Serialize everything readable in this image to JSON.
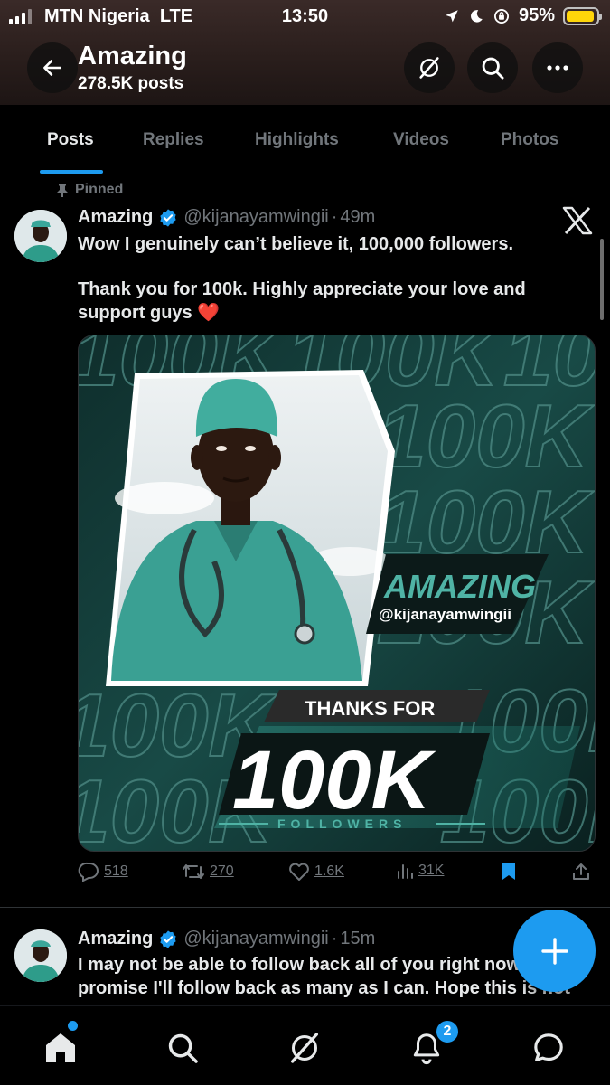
{
  "status_bar": {
    "carrier": "MTN Nigeria",
    "network": "LTE",
    "time": "13:50",
    "battery": "95%",
    "battery_level": 0.95,
    "battery_color": "#ffd60a"
  },
  "header": {
    "back_icon": "arrow-left-icon",
    "name": "Amazing",
    "posts_count": "278.5K posts",
    "grok_icon": "grok-icon",
    "search_icon": "search-icon",
    "more_icon": "more-icon"
  },
  "tabs": [
    {
      "label": "Posts",
      "active": true
    },
    {
      "label": "Replies",
      "active": false
    },
    {
      "label": "Highlights",
      "active": false
    },
    {
      "label": "Videos",
      "active": false
    },
    {
      "label": "Photos",
      "active": false
    }
  ],
  "pinned_post": {
    "pinned_label": "Pinned",
    "author": "Amazing",
    "handle": "@kijanayamwingii",
    "separator": "·",
    "time": "49m",
    "text_line1": "Wow I genuinely can’t believe it, 100,000 followers.",
    "text_line2": "Thank you for 100k. Highly appreciate  your love and",
    "text_line3": "support guys",
    "emoji": "❤️",
    "image": {
      "bg_text": "100K",
      "name": "AMAZING",
      "handle": "@kijanayamwingii",
      "thanks_for": "THANKS FOR",
      "big_count": "100K",
      "followers": "FOLLOWERS"
    },
    "stats": {
      "replies": "518",
      "reposts": "270",
      "likes": "1.6K",
      "views": "31K"
    }
  },
  "second_post": {
    "author": "Amazing",
    "handle": "@kijanayamwingii",
    "separator": "·",
    "time": "15m",
    "text_line1": "I may not be able to follow back all of you right now",
    "text_line2": "promise I'll follow back as many as I can. Hope this is not"
  },
  "bottom_nav": {
    "notification_count": "2",
    "accent": "#1d9bf0"
  }
}
